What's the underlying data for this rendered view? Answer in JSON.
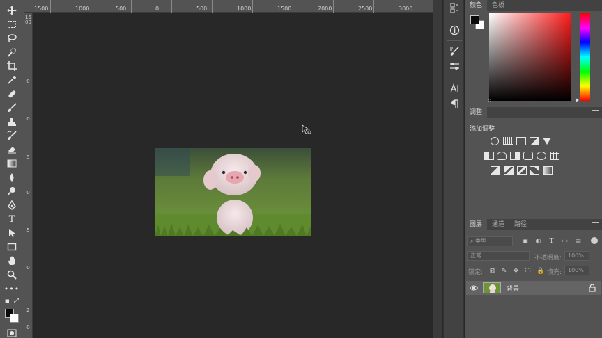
{
  "ruler_top": {
    "labels": [
      "1500",
      "1000",
      "500",
      "0",
      "500",
      "1000",
      "1500",
      "2000",
      "2500",
      "3000"
    ]
  },
  "ruler_left": {
    "labels": [
      "1500",
      "0",
      "0",
      "5",
      "0",
      "5",
      "0",
      "2",
      "0"
    ]
  },
  "panels": {
    "color": {
      "tabs": [
        "颜色",
        "色板"
      ],
      "foreground": "#000000",
      "background": "#ffffff"
    },
    "adjustments": {
      "tab": "调整",
      "title": "添加调整"
    },
    "layers": {
      "tabs": [
        "图层",
        "通道",
        "路径"
      ],
      "filter_placeholder": "类型",
      "blend_mode": "正常",
      "opacity_label": "不透明度:",
      "opacity_value": "100%",
      "lock_label": "锁定:",
      "fill_label": "填充:",
      "fill_value": "100%",
      "layer_name": "背景"
    }
  },
  "colors": {
    "app_bg": "#282828",
    "panel_bg": "#535353",
    "tab_bar": "#424242"
  }
}
